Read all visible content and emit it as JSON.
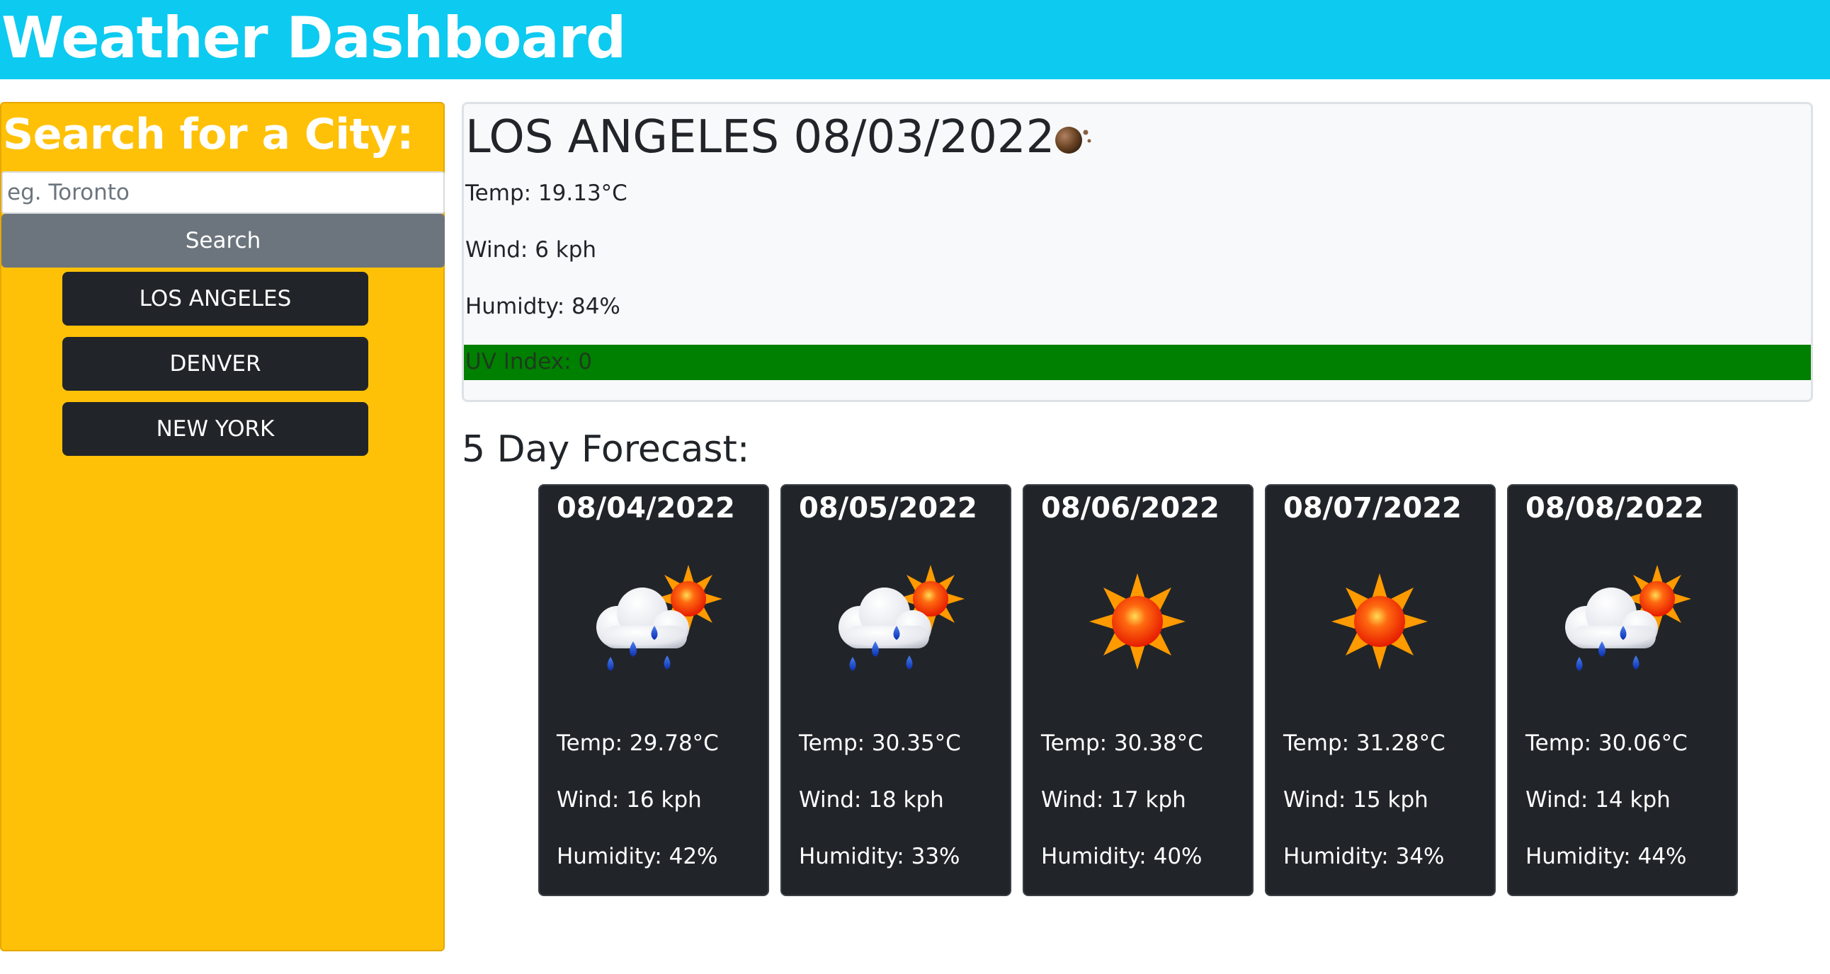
{
  "header": {
    "title": "Weather Dashboard"
  },
  "sidebar": {
    "heading": "Search for a City:",
    "search_placeholder": "eg. Toronto",
    "search_button": "Search",
    "history": [
      "LOS ANGELES",
      "DENVER",
      "NEW YORK"
    ]
  },
  "current": {
    "title": "LOS ANGELES 08/03/2022",
    "icon": "haze-icon",
    "temp": "Temp: 19.13°C",
    "wind": "Wind: 6 kph",
    "humidity": "Humidty: 84%",
    "uv": "UV Index: 0",
    "uv_color": "#008000"
  },
  "forecast": {
    "title": "5 Day Forecast:",
    "days": [
      {
        "date": "08/04/2022",
        "icon": "sun-cloud-rain-icon",
        "temp": "Temp: 29.78°C",
        "wind": "Wind: 16 kph",
        "humidity": "Humidity: 42%"
      },
      {
        "date": "08/05/2022",
        "icon": "sun-cloud-rain-icon",
        "temp": "Temp: 30.35°C",
        "wind": "Wind: 18 kph",
        "humidity": "Humidity: 33%"
      },
      {
        "date": "08/06/2022",
        "icon": "sun-icon",
        "temp": "Temp: 30.38°C",
        "wind": "Wind: 17 kph",
        "humidity": "Humidity: 40%"
      },
      {
        "date": "08/07/2022",
        "icon": "sun-icon",
        "temp": "Temp: 31.28°C",
        "wind": "Wind: 15 kph",
        "humidity": "Humidity: 34%"
      },
      {
        "date": "08/08/2022",
        "icon": "sun-cloud-rain-icon",
        "temp": "Temp: 30.06°C",
        "wind": "Wind: 14 kph",
        "humidity": "Humidity: 44%"
      }
    ]
  },
  "colors": {
    "header": "#0dcaf0",
    "sidebar": "#ffc107",
    "search_button": "#6c757d",
    "history_button": "#212529",
    "card": "#212529"
  }
}
